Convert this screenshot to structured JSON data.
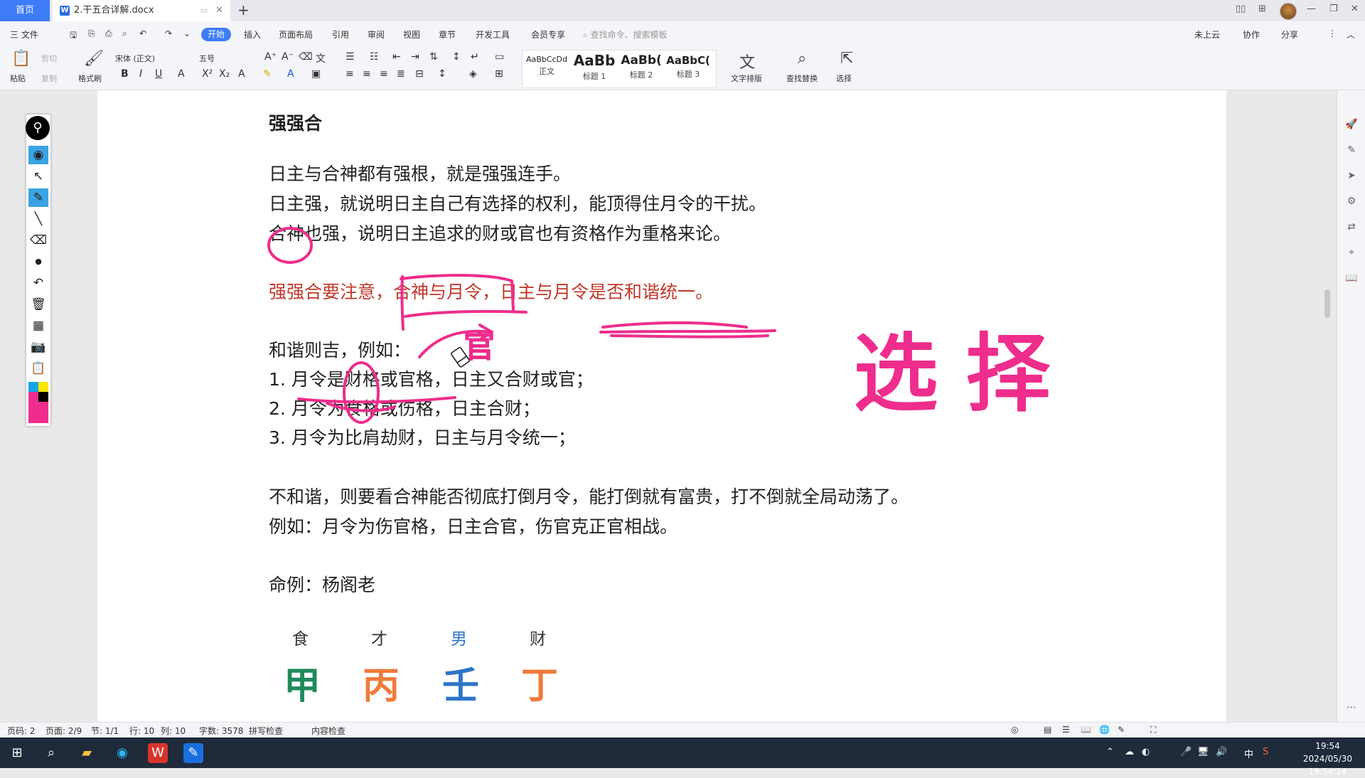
{
  "titlebar": {
    "home_tab": "首页",
    "doc_tab": "2.干五合详解.docx",
    "doc_icon": "W",
    "close": "✕",
    "new_tab": "+"
  },
  "menubar": {
    "file": "三 文件",
    "items": [
      "开始",
      "插入",
      "页面布局",
      "引用",
      "审阅",
      "视图",
      "章节",
      "开发工具",
      "会员专享"
    ],
    "search_placeholder": "查找命令、搜索模板",
    "cloud": "未上云",
    "collab": "协作",
    "share": "分享"
  },
  "ribbon": {
    "paste": "粘贴",
    "cut": "剪切",
    "copy": "复制",
    "format_painter": "格式刷",
    "font": "宋体 (正文)",
    "size": "五号",
    "styles": [
      {
        "sample": "AaBbCcDd",
        "label": "正文"
      },
      {
        "sample": "AaBb",
        "label": "标题 1"
      },
      {
        "sample": "AaBb(",
        "label": "标题 2"
      },
      {
        "sample": "AaBbC(",
        "label": "标题 3"
      }
    ],
    "text_layout": "文字排版",
    "find_replace": "查找替换",
    "select": "选择"
  },
  "document": {
    "heading": "强强合",
    "p1": "日主与合神都有强根，就是强强连手。",
    "p2": "日主强，就说明日主自己有选择的权利，能顶得住月令的干扰。",
    "p3": "合神也强，说明日主追求的财或官也有资格作为重格来论。",
    "p4": "强强合要注意，合神与月令，日主与月令是否和谐统一。",
    "p5": "和谐则吉，例如：",
    "list": [
      "1.  月令是财格或官格，日主又合财或官；",
      "2.  月令为食格或伤格，日主合财；",
      "3.  月令为比肩劫财，日主与月令统一；"
    ],
    "p6": "不和谐，则要看合神能否彻底打倒月令，能打倒就有富贵，打不倒就全局动荡了。",
    "p7": "例如：月令为伤官格，日主合官，伤官克正官相战。",
    "p8": "命例：杨阁老",
    "pillar_labels": [
      "食",
      "才",
      "男",
      "财"
    ],
    "pillar_chars": [
      "甲",
      "丙",
      "壬",
      "丁"
    ],
    "pillar_colors": [
      "#1f8a5a",
      "#f07a3a",
      "#2e74c9",
      "#f07a3a"
    ],
    "label_colors": [
      "#333333",
      "#333333",
      "#2e74c9",
      "#333333"
    ]
  },
  "handwriting": {
    "above_text": "官",
    "big_text": "选 择",
    "ink_color": "#ee2d8c"
  },
  "statusbar": {
    "page_num": "页码: 2",
    "page": "页面: 2/9",
    "section": "节: 1/1",
    "line": "行: 10",
    "col": "列: 10",
    "words": "字数: 3578",
    "spell": "拼写检查",
    "content_check": "内容检查"
  },
  "taskbar": {
    "ime": "中",
    "time": "19:54",
    "datetime": "2024/05/30 19:54:14"
  }
}
